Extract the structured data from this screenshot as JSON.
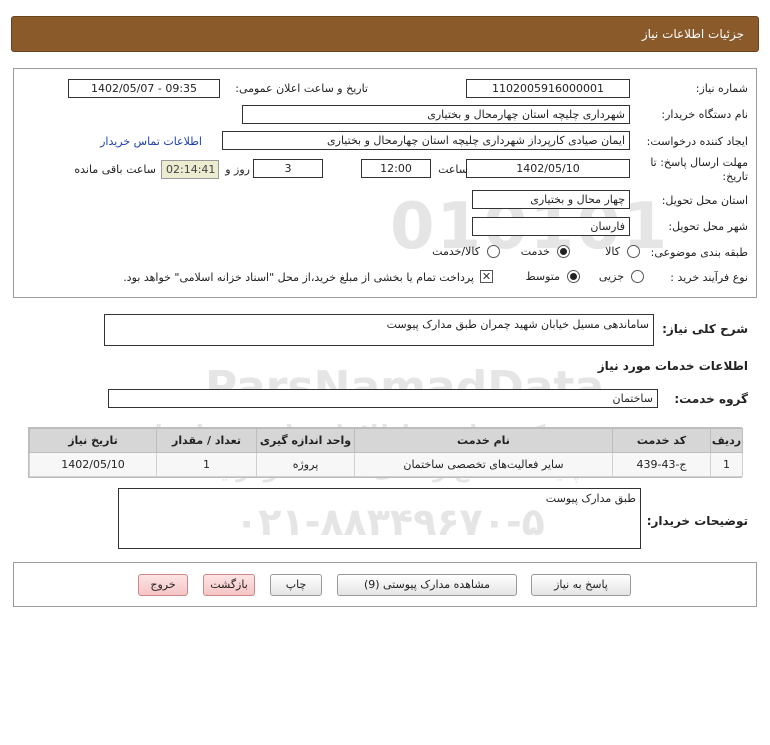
{
  "header": {
    "title": "جزئیات اطلاعات نیاز"
  },
  "watermark": {
    "logo_text": "ParsNamadData",
    "line1": "مرکز فراوری اطلاعات پارس نماد داده",
    "line2": "پایگاه اطلاع رسانی مناقصه ومزایده",
    "phone": "۰۲۱-۸۸۳۴۹۶۷۰-۵",
    "big_digits": "010101"
  },
  "form": {
    "need_number_label": "شماره نیاز:",
    "need_number": "1102005916000001",
    "announce_label": "تاریخ و ساعت اعلان عمومی:",
    "announce_value": "1402/05/07 - 09:35",
    "buyer_label": "نام دستگاه خریدار:",
    "buyer_value": "شهرداری چلیچه استان چهارمحال و بختیاری",
    "creator_label": "ایجاد کننده درخواست:",
    "creator_value": "ایمان صیادی کارپرداز شهرداری چلیچه استان چهارمحال و بختیاری",
    "contact_link": "اطلاعات تماس خریدار",
    "deadline_label_line1": "مهلت ارسال پاسخ: تا",
    "deadline_label_line2": "تاریخ:",
    "deadline_date": "1402/05/10",
    "time_label": "ساعت",
    "deadline_time": "12:00",
    "days_value": "3",
    "days_label": "روز و",
    "remaining_timer": "02:14:41",
    "remaining_label": "ساعت باقی مانده",
    "province_label": "استان محل تحویل:",
    "province_value": "چهار محال و بختیاری",
    "city_label": "شهر محل تحویل:",
    "city_value": "فارسان",
    "category_label": "طبقه بندی موضوعی:",
    "category_options": [
      {
        "label": "کالا",
        "selected": false
      },
      {
        "label": "خدمت",
        "selected": true
      },
      {
        "label": "کالا/خدمت",
        "selected": false
      }
    ],
    "purchase_label": "نوع فرآیند خرید :",
    "purchase_options": [
      {
        "label": "جزیی",
        "selected": false
      },
      {
        "label": "متوسط",
        "selected": true
      }
    ],
    "payment_checkbox_checked": true,
    "payment_note": "پرداخت تمام یا بخشی از مبلغ خرید،از محل \"اسناد خزانه اسلامی\" خواهد بود."
  },
  "description": {
    "label": "شرح کلی نیاز:",
    "value": "ساماندهی مسیل خیابان شهید چمران طبق مدارک پیوست"
  },
  "services": {
    "section_title": "اطلاعات خدمات مورد نیاز",
    "group_label": "گروه خدمت:",
    "group_value": "ساختمان",
    "columns": [
      "ردیف",
      "کد خدمت",
      "نام خدمت",
      "واحد اندازه گیری",
      "تعداد / مقدار",
      "تاریخ نیاز"
    ],
    "rows": [
      [
        "1",
        "ج-43-439",
        "سایر فعالیت‌های تخصصی ساختمان",
        "پروژه",
        "1",
        "1402/05/10"
      ]
    ]
  },
  "buyer_notes": {
    "label": "توضیحات خریدار:",
    "value": "طبق مدارک پیوست"
  },
  "buttons": {
    "reply": "پاسخ به نیاز",
    "attachments": "مشاهده مدارک پیوستی (9)",
    "print": "چاپ",
    "back": "بازگشت",
    "exit": "خروج"
  },
  "colors": {
    "header_bg": "#8a5a2b",
    "link": "#1b3fb0",
    "timer_bg": "#ececd0",
    "table_header_bg": "#d6d6d6",
    "red_button_bg": "#f5c4c4"
  }
}
